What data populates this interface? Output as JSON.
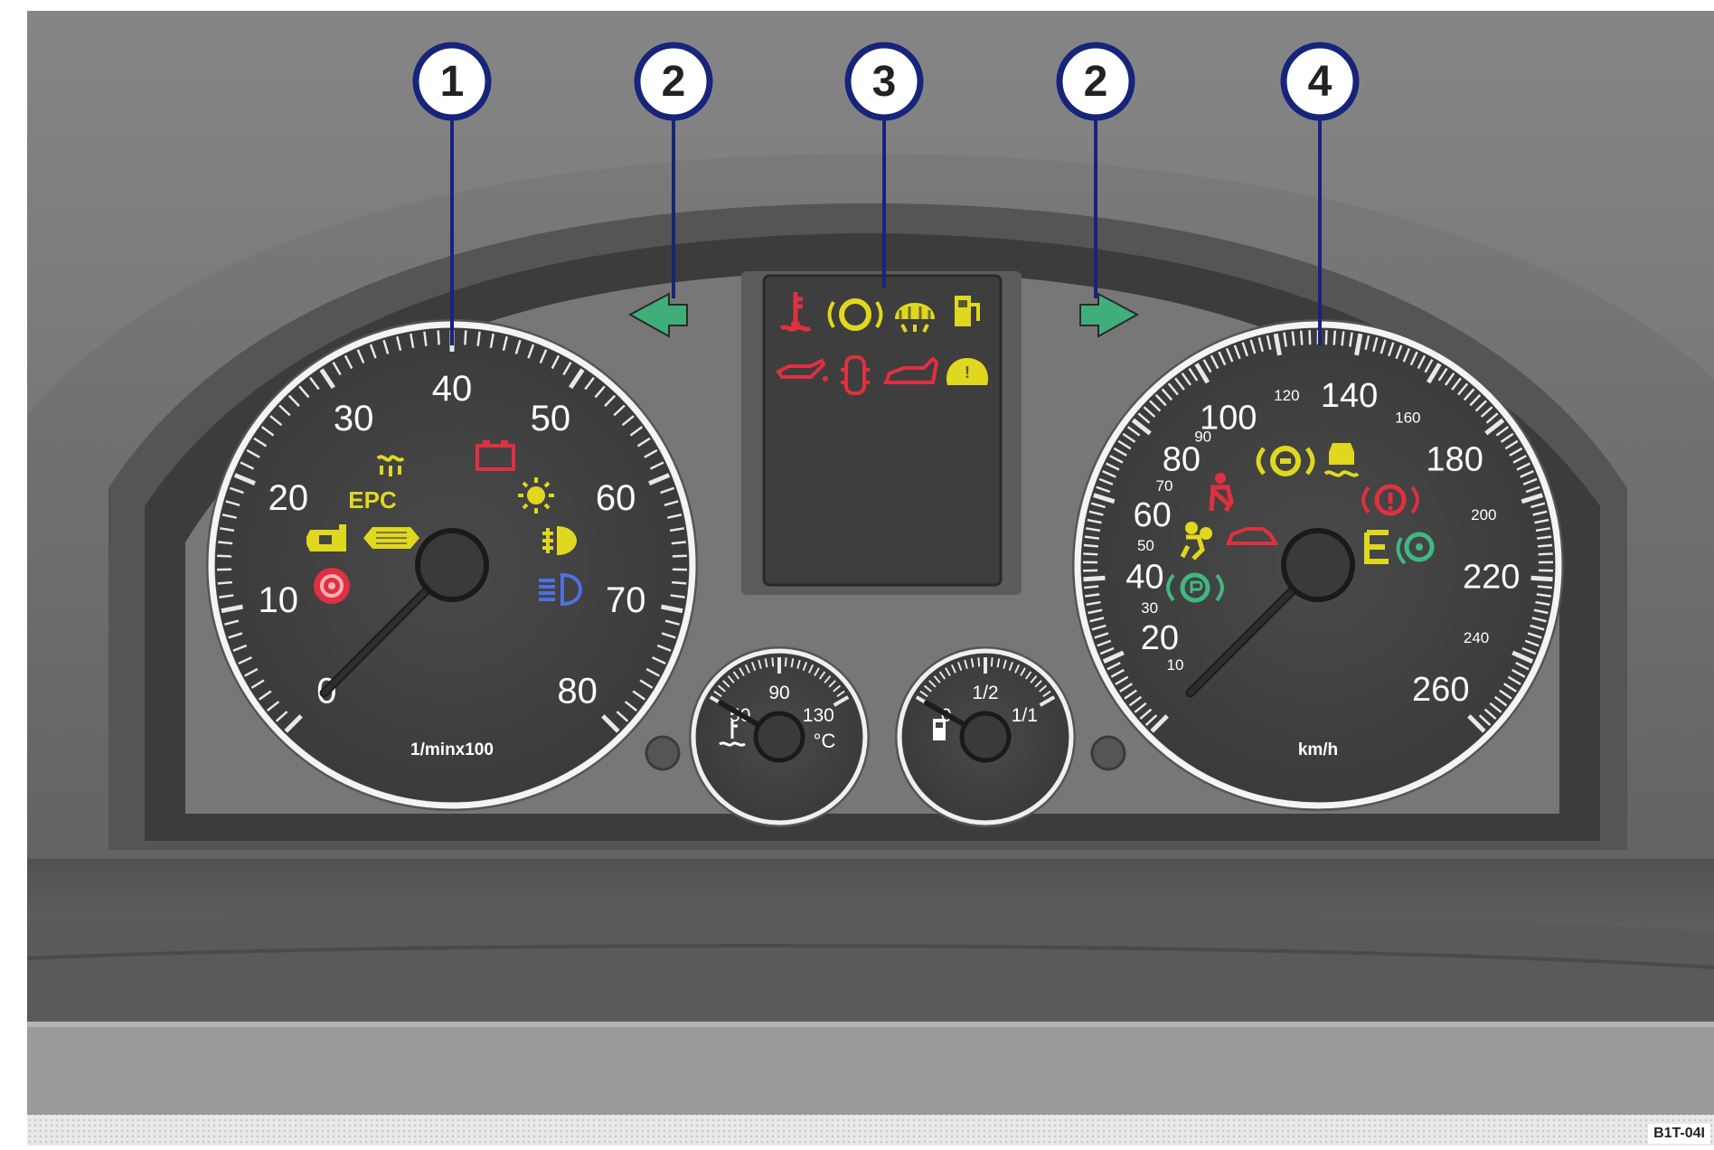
{
  "callouts": [
    "1",
    "2",
    "3",
    "2",
    "4"
  ],
  "tachometer": {
    "scale": [
      "0",
      "10",
      "20",
      "30",
      "40",
      "50",
      "60",
      "70",
      "80"
    ],
    "unit": "1/minx100",
    "needle_value": 0
  },
  "temperature_gauge": {
    "scale": [
      "50",
      "90",
      "130"
    ],
    "unit": "°C",
    "needle_value": 50
  },
  "fuel_gauge": {
    "scale": [
      "0",
      "1/2",
      "1/1"
    ],
    "needle_value": 0
  },
  "speedometer": {
    "scale_major": [
      "20",
      "40",
      "60",
      "80",
      "100",
      "140",
      "180",
      "220",
      "260"
    ],
    "scale_minor": [
      "10",
      "30",
      "50",
      "70",
      "90",
      "120",
      "160",
      "200",
      "240"
    ],
    "unit": "km/h",
    "needle_value": 0
  },
  "warning_lights": {
    "tachometer": [
      {
        "name": "glow-plug",
        "color": "#e0d81e"
      },
      {
        "name": "epc",
        "text": "EPC",
        "color": "#e0d81e"
      },
      {
        "name": "engine",
        "color": "#e0d81e"
      },
      {
        "name": "particulate-filter",
        "color": "#e0d81e"
      },
      {
        "name": "steering",
        "color": "#e03040"
      },
      {
        "name": "battery",
        "color": "#e03040"
      },
      {
        "name": "light-bulb-fault",
        "color": "#e0d81e"
      },
      {
        "name": "rear-fog",
        "color": "#e0d81e"
      },
      {
        "name": "high-beam",
        "color": "#5070e0"
      }
    ],
    "display": [
      {
        "name": "coolant",
        "color": "#e03040"
      },
      {
        "name": "brake-pad",
        "color": "#e0d81e"
      },
      {
        "name": "washer-fluid",
        "color": "#e0d81e"
      },
      {
        "name": "fuel",
        "color": "#e0d81e"
      },
      {
        "name": "oil-pressure",
        "color": "#e03040"
      },
      {
        "name": "door-open",
        "color": "#e03040"
      },
      {
        "name": "boot-open",
        "color": "#e03040"
      },
      {
        "name": "tyre-pressure",
        "color": "#e0d81e"
      }
    ],
    "speedometer": [
      {
        "name": "seat-belt",
        "color": "#e03040"
      },
      {
        "name": "brake-system-yellow",
        "color": "#e0d81e"
      },
      {
        "name": "esp",
        "color": "#e0d81e"
      },
      {
        "name": "brake-system-red",
        "color": "#e03040"
      },
      {
        "name": "airbag",
        "color": "#e0d81e"
      },
      {
        "name": "alarm",
        "color": "#e03040"
      },
      {
        "name": "cruise-control",
        "color": "#e0d81e"
      },
      {
        "name": "steering-assist",
        "color": "#40b880"
      },
      {
        "name": "parking-brake",
        "color": "#40b880"
      }
    ]
  },
  "turn_signal_color": "#3fae7a",
  "reference_code": "B1T-04I"
}
